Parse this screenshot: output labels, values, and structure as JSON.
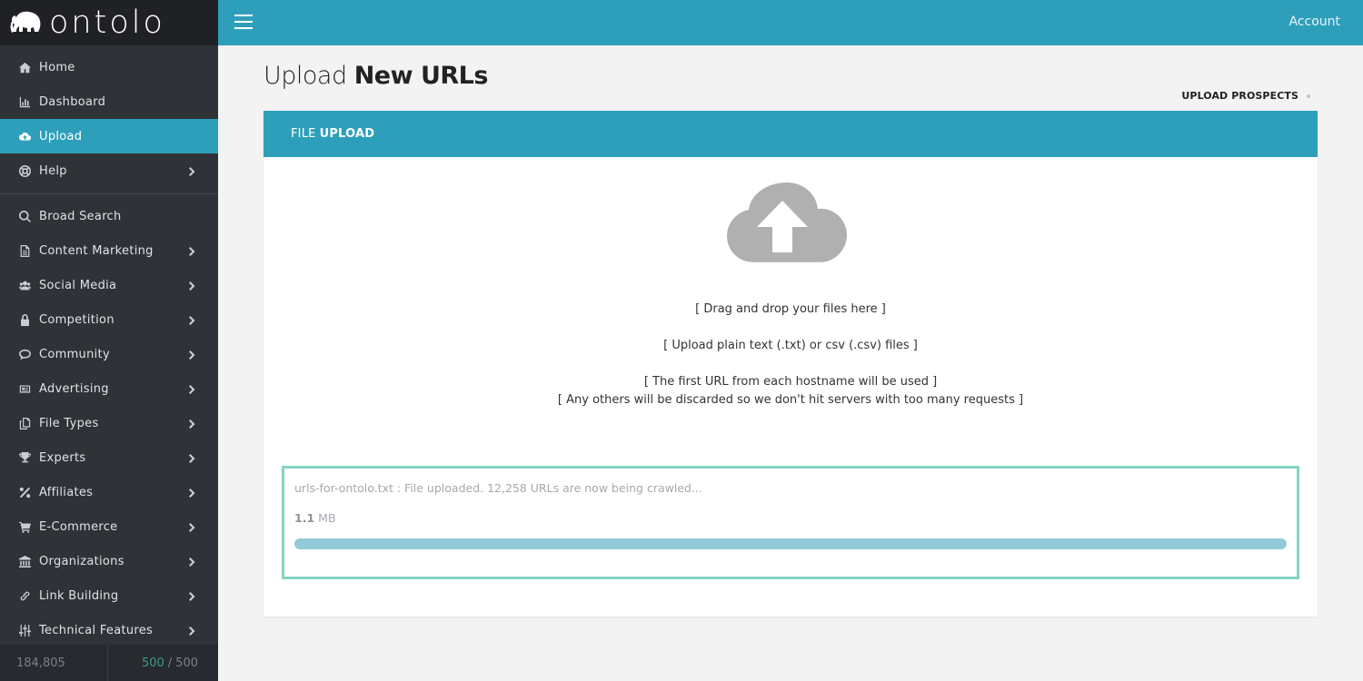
{
  "brand": {
    "name": "ontolo"
  },
  "topbar": {
    "account_label": "Account"
  },
  "sidebar": {
    "primary": [
      {
        "label": "Home",
        "icon": "home-icon"
      },
      {
        "label": "Dashboard",
        "icon": "bar-chart-icon"
      },
      {
        "label": "Upload",
        "icon": "cloud-upload-icon",
        "active": true
      },
      {
        "label": "Help",
        "icon": "life-ring-icon",
        "has_children": true
      }
    ],
    "tools": [
      {
        "label": "Broad Search",
        "icon": "search-icon"
      },
      {
        "label": "Content Marketing",
        "icon": "file-text-icon",
        "has_children": true
      },
      {
        "label": "Social Media",
        "icon": "users-icon",
        "has_children": true
      },
      {
        "label": "Competition",
        "icon": "lock-icon",
        "has_children": true
      },
      {
        "label": "Community",
        "icon": "comments-icon",
        "has_children": true
      },
      {
        "label": "Advertising",
        "icon": "newspaper-icon",
        "has_children": true
      },
      {
        "label": "File Types",
        "icon": "files-icon",
        "has_children": true
      },
      {
        "label": "Experts",
        "icon": "trophy-icon",
        "has_children": true
      },
      {
        "label": "Affiliates",
        "icon": "percent-icon",
        "has_children": true
      },
      {
        "label": "E-Commerce",
        "icon": "shopping-cart-icon",
        "has_children": true
      },
      {
        "label": "Organizations",
        "icon": "bank-icon",
        "has_children": true
      },
      {
        "label": "Link Building",
        "icon": "link-icon",
        "has_children": true
      },
      {
        "label": "Technical Features",
        "icon": "sliders-icon",
        "has_children": true
      }
    ],
    "footer": {
      "total": "184,805",
      "used": "500",
      "separator": "/",
      "limit": "500"
    }
  },
  "page": {
    "title_light": "Upload",
    "title_bold": "New URLs",
    "breadcrumb": "UPLOAD PROSPECTS"
  },
  "panel": {
    "header_light": "FILE",
    "header_bold": "UPLOAD",
    "dropzone_lines": [
      "[ Drag and drop your files here ]",
      "[ Upload plain text (.txt) or csv (.csv) files ]",
      "[ The first URL from each hostname will be used ]",
      "[ Any others will be discarded so we don't hit servers with too many requests ]"
    ],
    "upload": {
      "status": "urls-for-ontolo.txt : File uploaded. 12,258 URLs are now being crawled...",
      "size_value": "1.1",
      "size_unit": "MB",
      "progress": 1.0
    }
  },
  "colors": {
    "accent": "#2e9fbb",
    "sidebar_bg": "#2f3237",
    "upload_border": "#86d3c3",
    "progress_fill": "#92cad8",
    "quota_used": "#3f9c86"
  }
}
